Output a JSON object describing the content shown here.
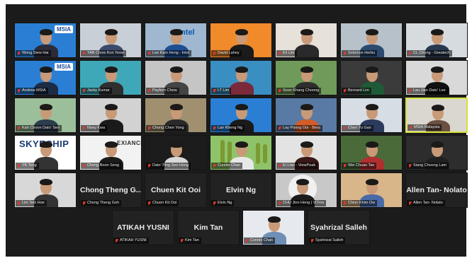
{
  "meeting": {
    "grid_rows": [
      [
        {
          "name": "Wong Siew Hai",
          "video": true,
          "bg": "#2a7fd4",
          "shirt": "#2b2b3a",
          "logo": "MSIA"
        },
        {
          "name": "YAB Chow Kon Yeow",
          "video": true,
          "bg": "#c9cfd6",
          "shirt": "#3b4a6a"
        },
        {
          "name": "Lee Kam Heng - Intel",
          "video": true,
          "bg": "#9fb7cf",
          "shirt": "#1e4f91",
          "logo": "intel"
        },
        {
          "name": "David Lahey",
          "video": true,
          "bg": "#f08a2a",
          "shirt": "#1b1b1b"
        },
        {
          "name": "Eli Lim",
          "video": true,
          "bg": "#e6e1d9",
          "shirt": "#2a2a2a"
        },
        {
          "name": "Solomon Herbu",
          "video": true,
          "bg": "#b7c1ca",
          "shirt": "#2c4a6f"
        },
        {
          "name": "CL Chong - Greatech",
          "video": true,
          "bg": "#d6dbe0",
          "shirt": "#27384f"
        }
      ],
      [
        {
          "name": "Andrew MSIA",
          "video": true,
          "bg": "#2a7fd4",
          "shirt": "#1c2c44",
          "logo": "MSIA"
        },
        {
          "name": "Jacky Kumar",
          "video": true,
          "bg": "#3fa8b8",
          "shirt": "#2f2f2f"
        },
        {
          "name": "Payfern Chew",
          "video": true,
          "bg": "#c5c5c5",
          "shirt": "#444"
        },
        {
          "name": "LT Lim",
          "video": true,
          "bg": "#3a8fc2",
          "shirt": "#7a2a3a"
        },
        {
          "name": "Soon Khang Choong",
          "video": true,
          "bg": "#6f9a5a",
          "shirt": "#2e2e2e"
        },
        {
          "name": "Bernard Lim",
          "video": true,
          "bg": "#3b3b3b",
          "shirt": "#1f5a38"
        },
        {
          "name": "Lau Jian Dato' Lee",
          "video": true,
          "bg": "#d9d9d9",
          "shirt": "#111"
        }
      ],
      [
        {
          "name": "Kah Choon Dato' Seri",
          "video": true,
          "bg": "#9bbf9a",
          "shirt": "#2d3d4d"
        },
        {
          "name": "Noey Kwa",
          "video": true,
          "bg": "#d2d2d2",
          "shirt": "#1a1a1a"
        },
        {
          "name": "Chong Chee Yong",
          "video": true,
          "bg": "#a09070",
          "shirt": "#2a2a2a"
        },
        {
          "name": "Lan Kheng Ng",
          "video": true,
          "bg": "#2a7fd4",
          "shirt": "#1a1a1a"
        },
        {
          "name": "Lay Poong Ooi - Bera",
          "video": true,
          "bg": "#5a7aa6",
          "shirt": "#d35d2a"
        },
        {
          "name": "Chen Yu Gan",
          "video": true,
          "bg": "#d7dde5",
          "shirt": "#2b3b5b"
        },
        {
          "name": "MSIA Malaysia",
          "video": true,
          "bg": "#dad7d0",
          "shirt": "#6a5040",
          "active": true
        }
      ],
      [
        {
          "name": "YK Tong",
          "video": true,
          "bg": "#ffffff",
          "shirt": "#333",
          "banner": "SKYECHIP"
        },
        {
          "name": "Chong Boon Seng",
          "video": true,
          "bg": "#f2f2f2",
          "shirt": "#1b1b1b",
          "banner": "EXIANCE"
        },
        {
          "name": "Dato' Ping Soo Hong",
          "video": true,
          "bg": "#1c1c1c",
          "shirt": "#d8d8d8"
        },
        {
          "name": "Connie Chan",
          "video": true,
          "bg": "#8fc36a",
          "shirt": "#e8e8e8"
        },
        {
          "name": "Ei Lian - ViewPeak",
          "video": true,
          "bg": "#e3e3e3",
          "shirt": "#3a1818"
        },
        {
          "name": "Wei Chuan Tan",
          "video": true,
          "bg": "#4a6a3a",
          "shirt": "#b03030"
        },
        {
          "name": "Siang Choong Lam",
          "video": true,
          "bg": "#2d2d2d",
          "shirt": "#202020"
        }
      ],
      [
        {
          "name": "Lim Teik Hoe",
          "video": true,
          "bg": "#d8d8d8",
          "shirt": "#333"
        },
        {
          "name": "Chong Theng Goh",
          "title": "Chong Theng G...",
          "video": false
        },
        {
          "name": "Chuen Kit Ooi",
          "title": "Chuen Kit Ooi",
          "video": false
        },
        {
          "name": "Elvin Ng",
          "title": "Elvin Ng",
          "video": false
        },
        {
          "name": "CHU Jinn Heng | ViTrox",
          "video": true,
          "bg": "#c8c8c8",
          "shirt": "#1c1c1c",
          "circle": true
        },
        {
          "name": "Chinn Khim Ow",
          "video": true,
          "bg": "#d9b58a",
          "shirt": "#4a6aa6"
        },
        {
          "name": "Allen Tan- Nolato",
          "title": "Allen Tan- Nolato",
          "video": false
        }
      ]
    ],
    "last_row": [
      {
        "name": "ATIKAH YUSNI",
        "title": "ATIKAH YUSNI",
        "video": false
      },
      {
        "name": "Kim Tan",
        "title": "Kim Tan",
        "video": false
      },
      {
        "name": "Connie Chan",
        "video": true,
        "bg": "#e6e9ee",
        "shirt": "#6f8fb5"
      },
      {
        "name": "Syahrizal Salleh",
        "title": "Syahrizal Salleh",
        "video": false
      }
    ],
    "colors": {
      "stage_bg": "#1b1b1b",
      "tile_bg": "#222222",
      "muted_icon": "#e23b2e",
      "active_speaker_border": "#d8e23a"
    },
    "icons": {
      "muted": "mic-off-icon"
    }
  }
}
